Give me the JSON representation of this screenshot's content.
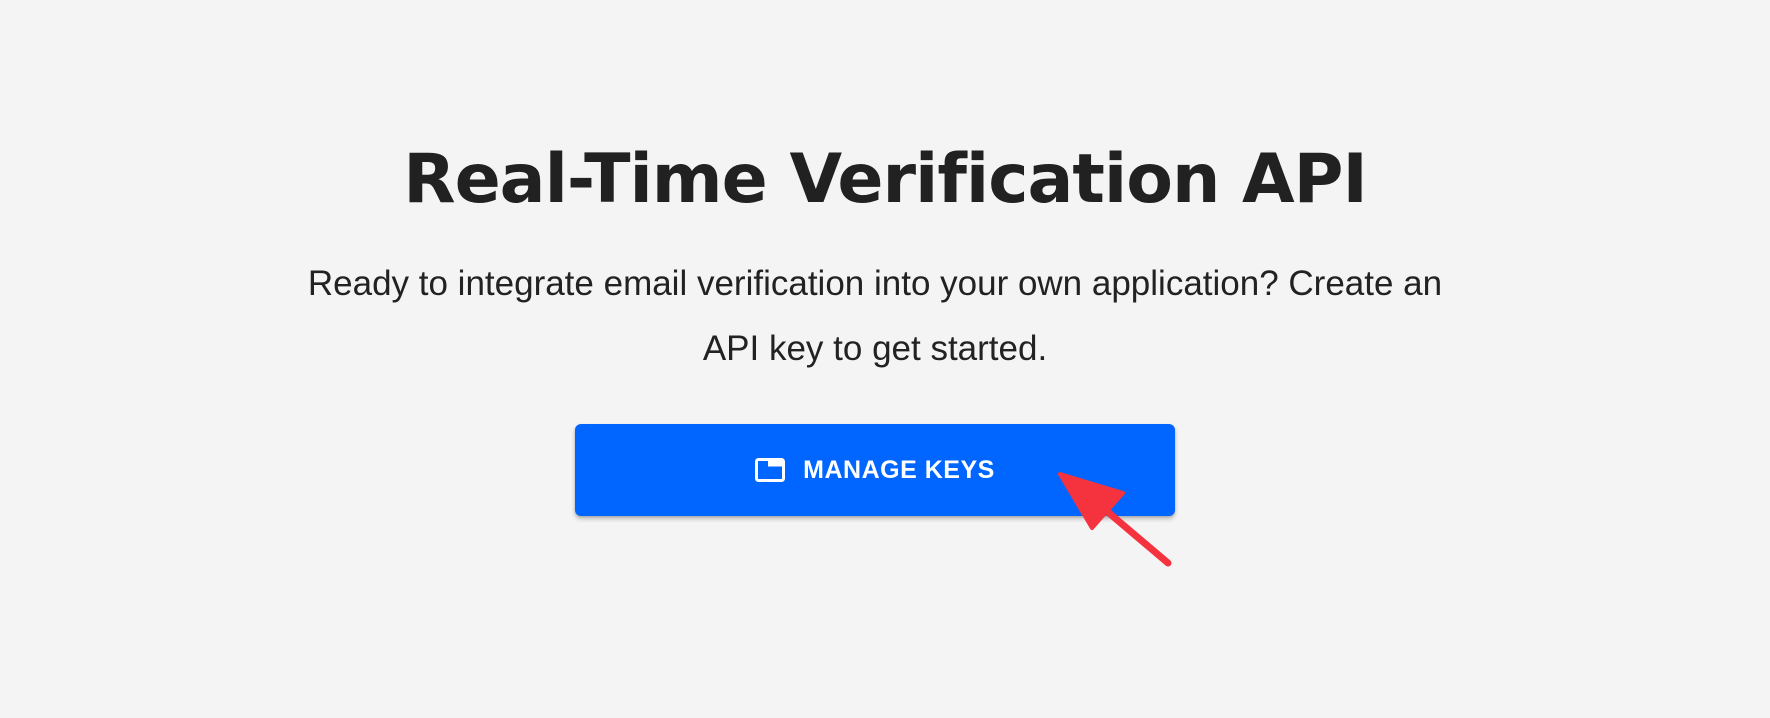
{
  "hero": {
    "title": "Real-Time Verification API",
    "subtitle": "Ready to integrate email verification into your own application? Create an API key to get started.",
    "button": {
      "label": "MANAGE KEYS",
      "icon": "browser-window-icon"
    }
  },
  "colors": {
    "background": "#f4f4f4",
    "title_text": "#212121",
    "button_background": "#0066ff",
    "button_text": "#ffffff",
    "annotation_arrow": "#f5333f"
  }
}
